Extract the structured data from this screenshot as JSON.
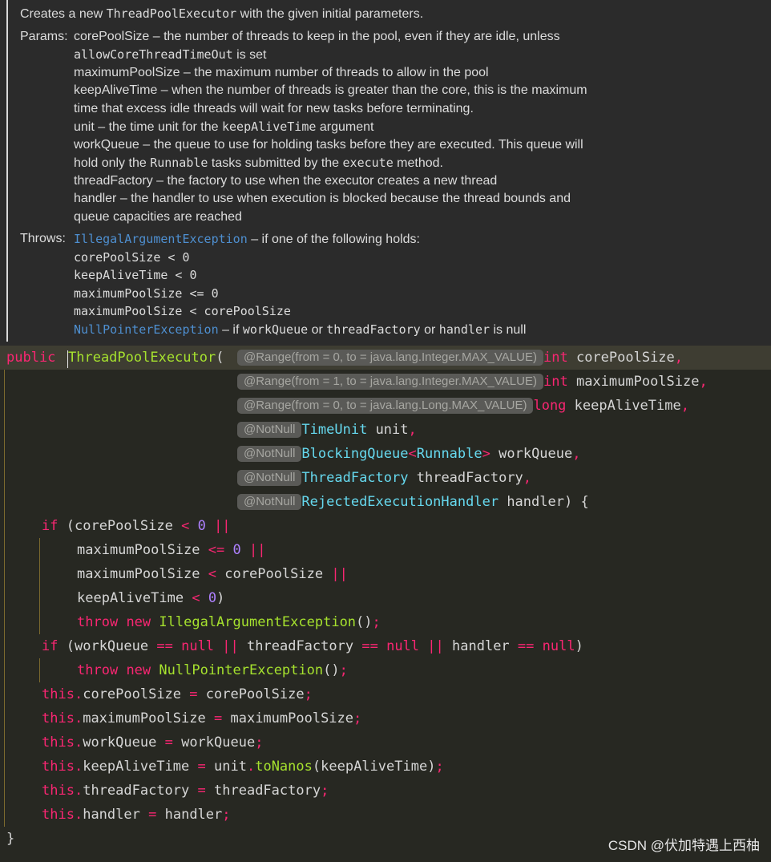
{
  "doc": {
    "summary_pre": "Creates a new ",
    "summary_code": "ThreadPoolExecutor",
    "summary_post": " with the given initial parameters.",
    "params_label": "Params:",
    "p1a": "corePoolSize – the number of threads to keep in the pool, even if they are idle, unless",
    "p1b_code": "allowCoreThreadTimeOut",
    "p1b_post": " is set",
    "p2": "maximumPoolSize – the maximum number of threads to allow in the pool",
    "p3a": "keepAliveTime – when the number of threads is greater than the core, this is the maximum",
    "p3b": "time that excess idle threads will wait for new tasks before terminating.",
    "p4_pre": "unit – the time unit for the ",
    "p4_code": "keepAliveTime",
    "p4_post": " argument",
    "p5a": "workQueue – the queue to use for holding tasks before they are executed. This queue will",
    "p5b_pre": "hold only the ",
    "p5b_code": "Runnable",
    "p5b_mid": " tasks submitted by the ",
    "p5b_code2": "execute",
    "p5b_post": " method.",
    "p6": "threadFactory – the factory to use when the executor creates a new thread",
    "p7a": "handler – the handler to use when execution is blocked because the thread bounds and",
    "p7b": "queue capacities are reached",
    "throws_label": "Throws:",
    "t1_link": "IllegalArgumentException",
    "t1_post": " – if one of the following holds:",
    "t2": "corePoolSize < 0",
    "t3": "keepAliveTime < 0",
    "t4": "maximumPoolSize <= 0",
    "t5": "maximumPoolSize < corePoolSize",
    "t6_link": "NullPointerException",
    "t6_pre": " – if ",
    "t6_c1": "workQueue",
    "t6_or": " or ",
    "t6_c2": "threadFactory",
    "t6_or2": " or ",
    "t6_c3": "handler",
    "t6_post": " is null"
  },
  "code": {
    "public": "public",
    "ctor": "ThreadPoolExecutor",
    "lparen": "(",
    "ann1": "@Range(from = 0, to = java.lang.Integer.MAX_VALUE)",
    "ann2": "@Range(from = 1, to = java.lang.Integer.MAX_VALUE)",
    "ann3": "@Range(from = 0, to = java.lang.Long.MAX_VALUE)",
    "notnull": "@NotNull",
    "int": "int",
    "long": "long",
    "p_core": "corePoolSize",
    "p_max": "maximumPoolSize",
    "p_keep": "keepAliveTime",
    "comma": ",",
    "t_unit": "TimeUnit",
    "p_unit": "unit",
    "t_bq": "BlockingQueue",
    "lt": "<",
    "t_runnable": "Runnable",
    "gt": ">",
    "p_wq": "workQueue",
    "t_tf": "ThreadFactory",
    "p_tf": "threadFactory",
    "t_reh": "RejectedExecutionHandler",
    "p_h": "handler",
    "close_brace_open": ") {",
    "if": "if",
    "open": "(",
    "close": ")",
    "lt_op": "<",
    "le_op": "<=",
    "eq_op": "==",
    "or_op": "||",
    "zero": "0",
    "null": "null",
    "throw": "throw",
    "new": "new",
    "iae": "IllegalArgumentException",
    "npe": "NullPointerException",
    "call_end": "()",
    "semi": ";",
    "this": "this",
    "dot": ".",
    "assign": "=",
    "toNanos": "toNanos",
    "end_brace": "}"
  },
  "watermark": "CSDN @伏加特遇上西柚"
}
